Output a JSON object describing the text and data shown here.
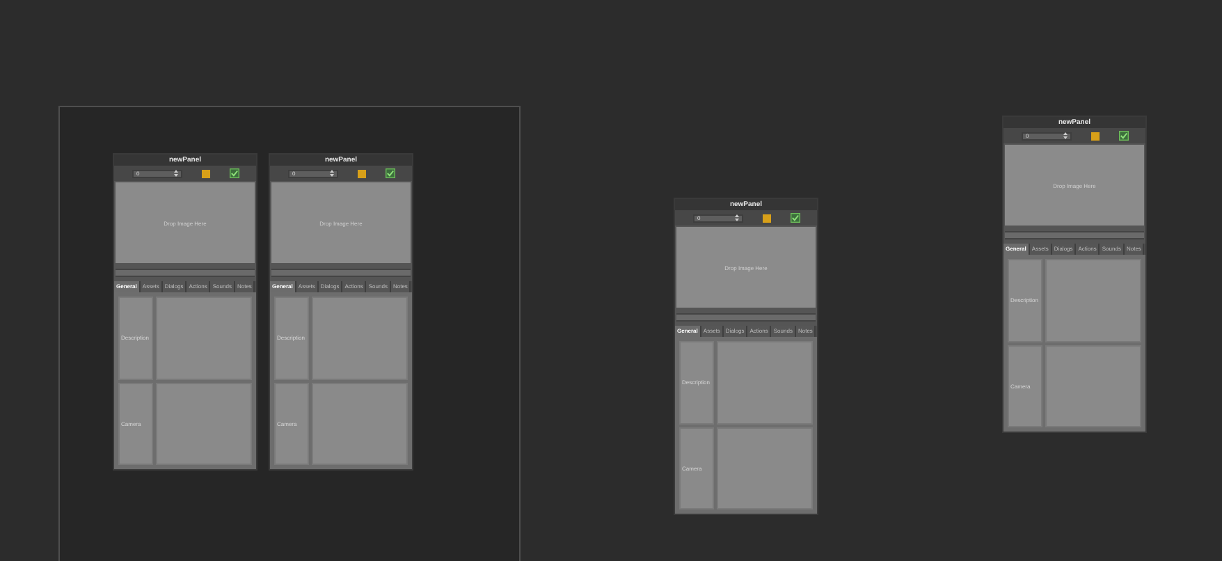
{
  "frame": {
    "panels": [
      {
        "title": "newPanel",
        "spin_value": "0",
        "drop_text": "Drop Image Here",
        "tabs": [
          {
            "label": "General",
            "selected": true
          },
          {
            "label": "Assets",
            "selected": false
          },
          {
            "label": "Dialogs",
            "selected": false
          },
          {
            "label": "Actions",
            "selected": false
          },
          {
            "label": "Sounds",
            "selected": false
          },
          {
            "label": "Notes",
            "selected": false
          }
        ],
        "rows": [
          {
            "label": "Description"
          },
          {
            "label": "Camera"
          }
        ]
      },
      {
        "title": "newPanel",
        "spin_value": "0",
        "drop_text": "Drop Image Here",
        "tabs": [
          {
            "label": "General",
            "selected": true
          },
          {
            "label": "Assets",
            "selected": false
          },
          {
            "label": "Dialogs",
            "selected": false
          },
          {
            "label": "Actions",
            "selected": false
          },
          {
            "label": "Sounds",
            "selected": false
          },
          {
            "label": "Notes",
            "selected": false
          }
        ],
        "rows": [
          {
            "label": "Description"
          },
          {
            "label": "Camera"
          }
        ]
      }
    ]
  },
  "panels": [
    {
      "title": "newPanel",
      "spin_value": "0",
      "drop_text": "Drop Image Here",
      "tabs": [
        {
          "label": "General",
          "selected": true
        },
        {
          "label": "Assets",
          "selected": false
        },
        {
          "label": "Dialogs",
          "selected": false
        },
        {
          "label": "Actions",
          "selected": false
        },
        {
          "label": "Sounds",
          "selected": false
        },
        {
          "label": "Notes",
          "selected": false
        }
      ],
      "rows": [
        {
          "label": "Description"
        },
        {
          "label": "Camera"
        }
      ]
    },
    {
      "title": "newPanel",
      "spin_value": "0",
      "drop_text": "Drop Image Here",
      "tabs": [
        {
          "label": "General",
          "selected": true
        },
        {
          "label": "Assets",
          "selected": false
        },
        {
          "label": "Dialogs",
          "selected": false
        },
        {
          "label": "Actions",
          "selected": false
        },
        {
          "label": "Sounds",
          "selected": false
        },
        {
          "label": "Notes",
          "selected": false
        }
      ],
      "rows": [
        {
          "label": "Description"
        },
        {
          "label": "Camera"
        }
      ]
    }
  ]
}
